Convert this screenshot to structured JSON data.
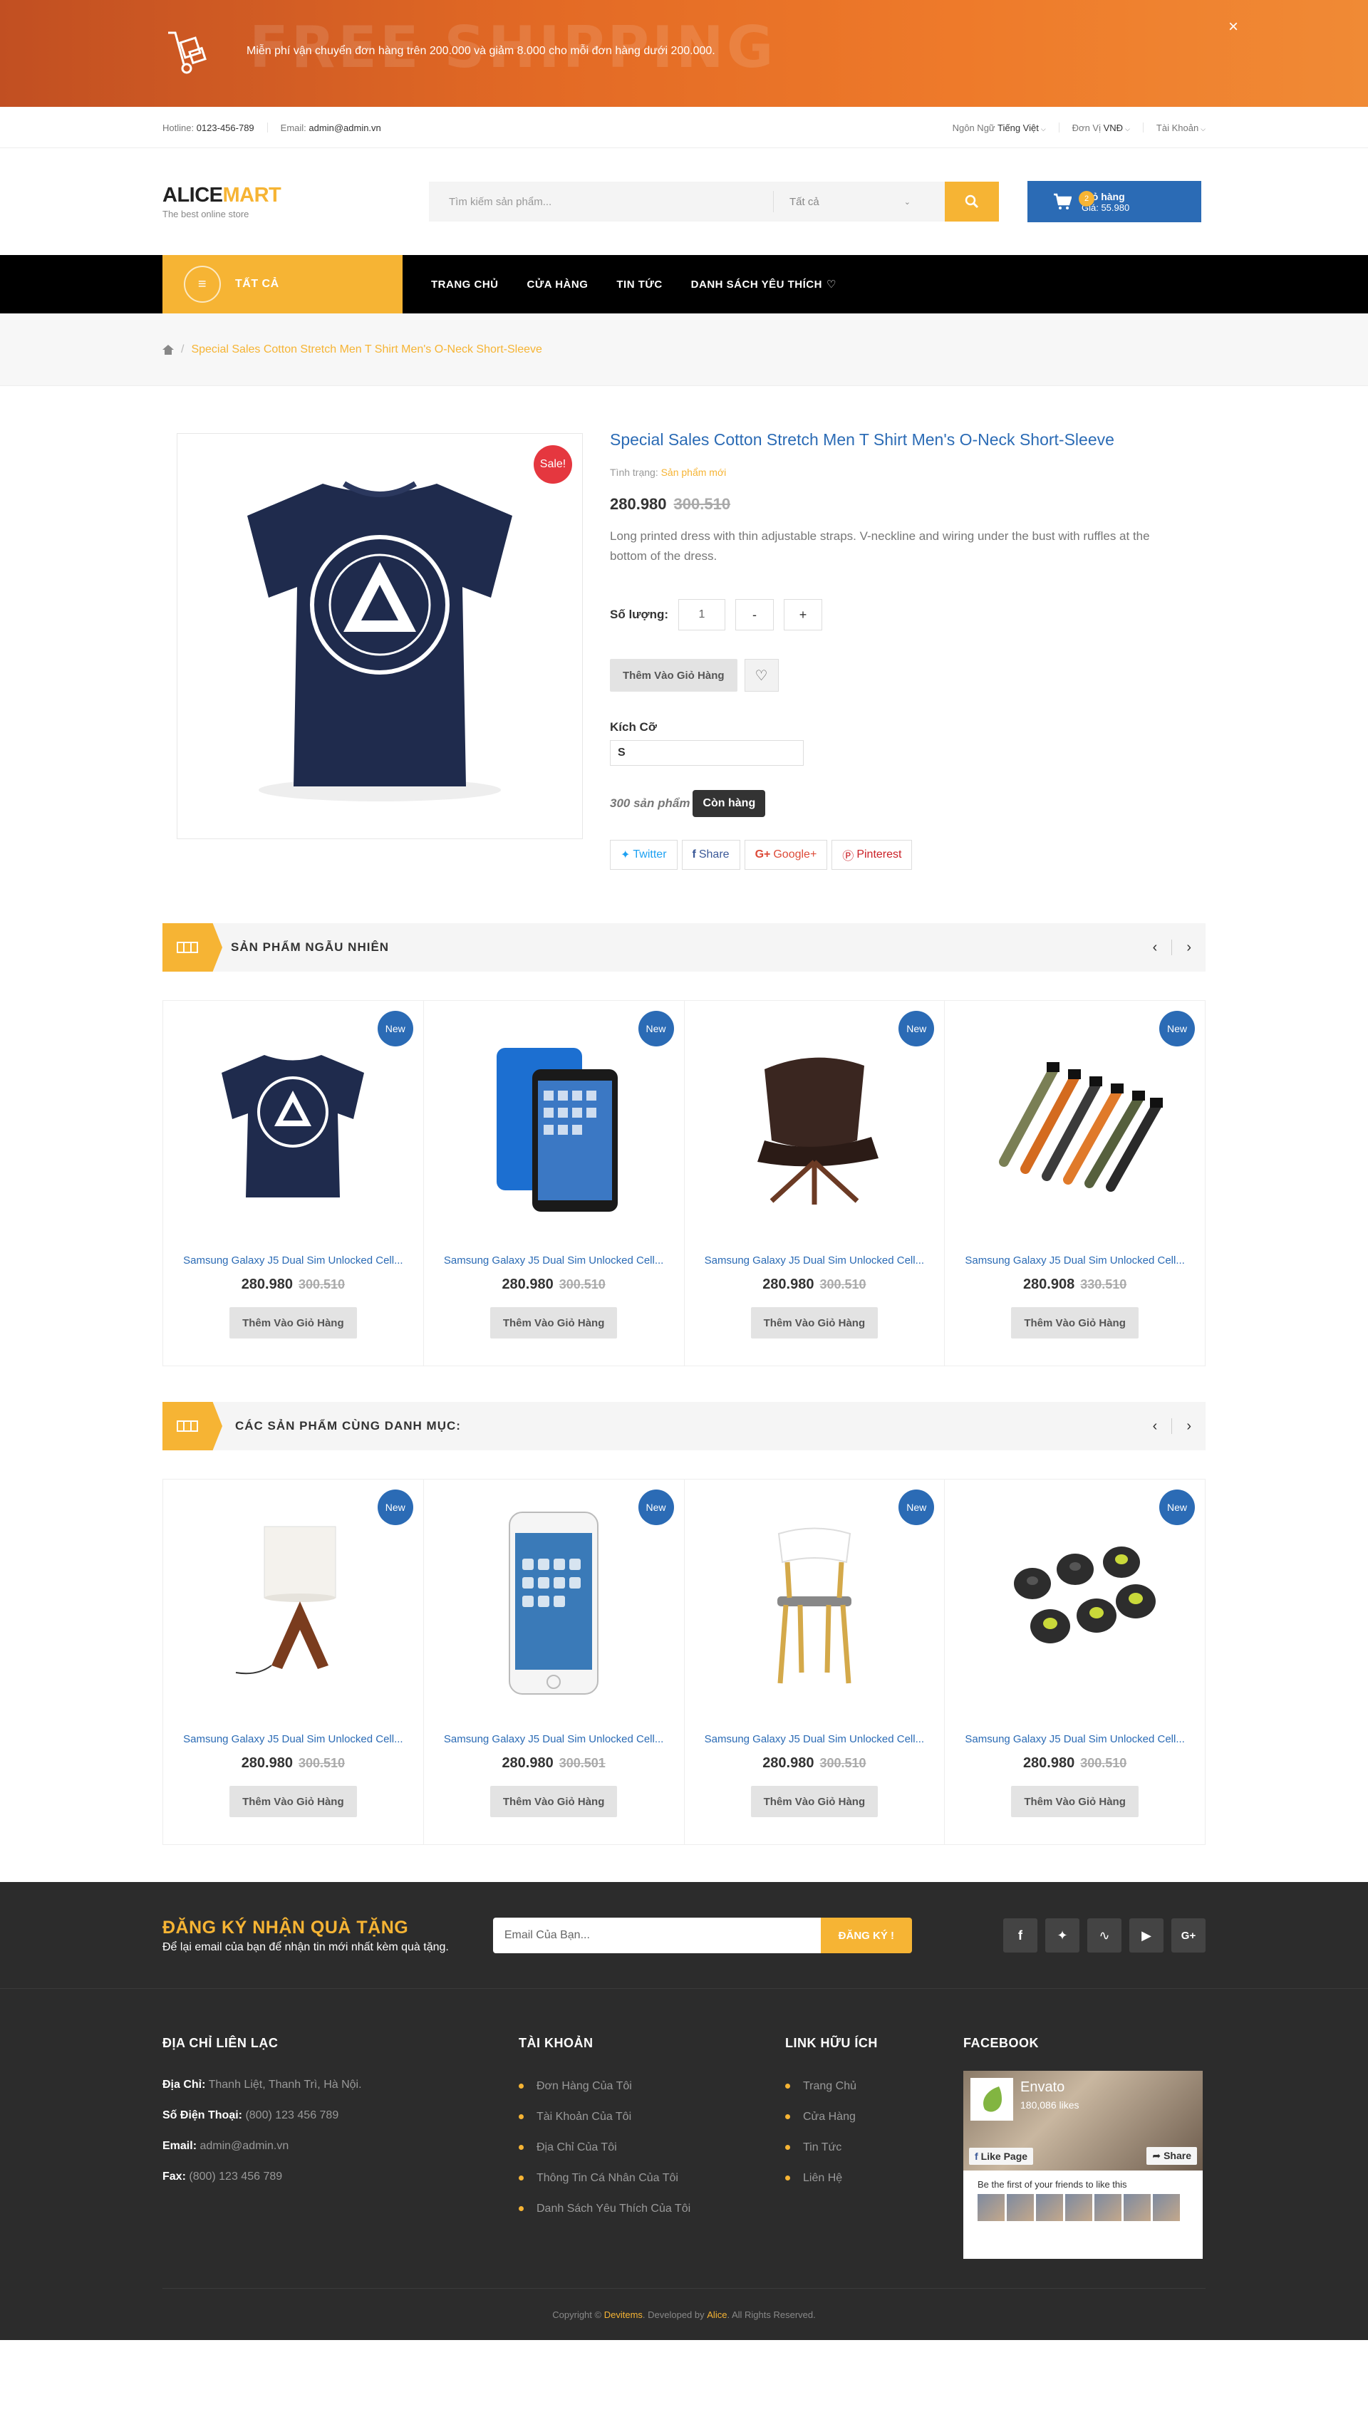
{
  "promo": {
    "ghost": "FREE SHIPPING",
    "text": "Miễn phí vận chuyển đơn hàng trên 200.000 và giảm 8.000 cho mỗi đơn hàng dưới 200.000.",
    "close": "×"
  },
  "topbar": {
    "hotline_label": "Hotline:",
    "hotline": "0123-456-789",
    "email_label": "Email:",
    "email": "admin@admin.vn",
    "lang_label": "Ngôn Ngữ",
    "lang": "Tiếng Việt",
    "cur_label": "Đơn Vị",
    "cur": "VNĐ",
    "account": "Tài Khoản"
  },
  "logo": {
    "part1": "ALICE",
    "part2": "MART",
    "tagline": "The best online store"
  },
  "search": {
    "placeholder": "Tìm kiếm sản phẩm...",
    "category": "Tất cả"
  },
  "cart": {
    "count": "2",
    "title": "Giỏ hàng",
    "total": "Giá: 55.980"
  },
  "nav": {
    "all": "TẤT CẢ",
    "items": [
      "TRANG CHỦ",
      "CỬA HÀNG",
      "TIN TỨC",
      "DANH SÁCH YÊU THÍCH"
    ]
  },
  "breadcrumb": {
    "sep": "/",
    "current": "Special Sales Cotton Stretch Men T Shirt Men's O-Neck Short-Sleeve"
  },
  "product": {
    "sale": "Sale!",
    "title": "Special Sales Cotton Stretch Men T Shirt Men's O-Neck Short-Sleeve",
    "status_label": "Tình trạng:",
    "status": "Sản phẩm mới",
    "price": "280.980",
    "old_price": "300.510",
    "desc": "Long printed dress with thin adjustable straps. V-neckline and wiring under the bust with ruffles at the bottom of the dress.",
    "qty_label": "Số lượng:",
    "qty": "1",
    "minus": "-",
    "plus": "+",
    "add": "Thêm Vào Giỏ Hàng",
    "size_label": "Kích Cỡ",
    "size": "S",
    "stock_count": "300 sản phẩm",
    "stock_status": "Còn hàng",
    "share": [
      "Twitter",
      "Share",
      "Google+",
      "Pinterest"
    ]
  },
  "sections": [
    {
      "title": "SẢN PHẨM NGẪU NHIÊN",
      "products": [
        {
          "badge": "New",
          "name": "Samsung Galaxy J5 Dual Sim Unlocked Cell...",
          "price": "280.980",
          "old": "300.510",
          "add": "Thêm Vào Giỏ Hàng",
          "img": "tshirt"
        },
        {
          "badge": "New",
          "name": "Samsung Galaxy J5 Dual Sim Unlocked Cell...",
          "price": "280.980",
          "old": "300.510",
          "add": "Thêm Vào Giỏ Hàng",
          "img": "tablet"
        },
        {
          "badge": "New",
          "name": "Samsung Galaxy J5 Dual Sim Unlocked Cell...",
          "price": "280.980",
          "old": "300.510",
          "add": "Thêm Vào Giỏ Hàng",
          "img": "chair"
        },
        {
          "badge": "New",
          "name": "Samsung Galaxy J5 Dual Sim Unlocked Cell...",
          "price": "280.908",
          "old": "330.510",
          "add": "Thêm Vào Giỏ Hàng",
          "img": "bracelets"
        }
      ]
    },
    {
      "title": "CÁC SẢN PHẨM CÙNG DANH MỤC:",
      "products": [
        {
          "badge": "New",
          "name": "Samsung Galaxy J5 Dual Sim Unlocked Cell...",
          "price": "280.980",
          "old": "300.510",
          "add": "Thêm Vào Giỏ Hàng",
          "img": "lamp"
        },
        {
          "badge": "New",
          "name": "Samsung Galaxy J5 Dual Sim Unlocked Cell...",
          "price": "280.980",
          "old": "300.501",
          "add": "Thêm Vào Giỏ Hàng",
          "img": "iphone"
        },
        {
          "badge": "New",
          "name": "Samsung Galaxy J5 Dual Sim Unlocked Cell...",
          "price": "280.980",
          "old": "300.510",
          "add": "Thêm Vào Giỏ Hàng",
          "img": "woodchair"
        },
        {
          "badge": "New",
          "name": "Samsung Galaxy J5 Dual Sim Unlocked Cell...",
          "price": "280.980",
          "old": "300.510",
          "add": "Thêm Vào Giỏ Hàng",
          "img": "eartips"
        }
      ]
    }
  ],
  "newsletter": {
    "title": "ĐĂNG KÝ NHẬN QUÀ TẶNG",
    "subtitle": "Để lại email của bạn để nhận tin mới nhất kèm quà tặng.",
    "placeholder": "Email Của Bạn...",
    "button": "ĐĂNG KÝ !",
    "social_icons": [
      "facebook-icon",
      "twitter-icon",
      "rss-icon",
      "youtube-icon",
      "google-plus-icon"
    ]
  },
  "footer": {
    "contact": {
      "title": "ĐỊA CHỈ LIÊN LẠC",
      "address_label": "Địa Chỉ:",
      "address": "Thanh Liệt, Thanh Trì, Hà Nội.",
      "phone_label": "Số Điện Thoại:",
      "phone": "(800) 123 456 789",
      "email_label": "Email:",
      "email": "admin@admin.vn",
      "fax_label": "Fax:",
      "fax": "(800) 123 456 789"
    },
    "account": {
      "title": "TÀI KHOẢN",
      "items": [
        "Đơn Hàng Của Tôi",
        "Tài Khoản Của Tôi",
        "Địa Chỉ Của Tôi",
        "Thông Tin Cá Nhân Của Tôi",
        "Danh Sách Yêu Thích Của Tôi"
      ]
    },
    "links": {
      "title": "LINK HỮU ÍCH",
      "items": [
        "Trang Chủ",
        "Cửa Hàng",
        "Tin Tức",
        "Liên Hệ"
      ]
    },
    "facebook": {
      "title": "FACEBOOK",
      "page": "Envato",
      "likes": "180,086 likes",
      "like_btn": "Like Page",
      "share_btn": "Share",
      "friends": "Be the first of your friends to like this"
    },
    "copy": {
      "pre": "Copyright ©",
      "brand": "Devitems",
      "mid": ". Developed by",
      "dev": "Alice",
      "post": ". All Rights Reserved."
    }
  }
}
